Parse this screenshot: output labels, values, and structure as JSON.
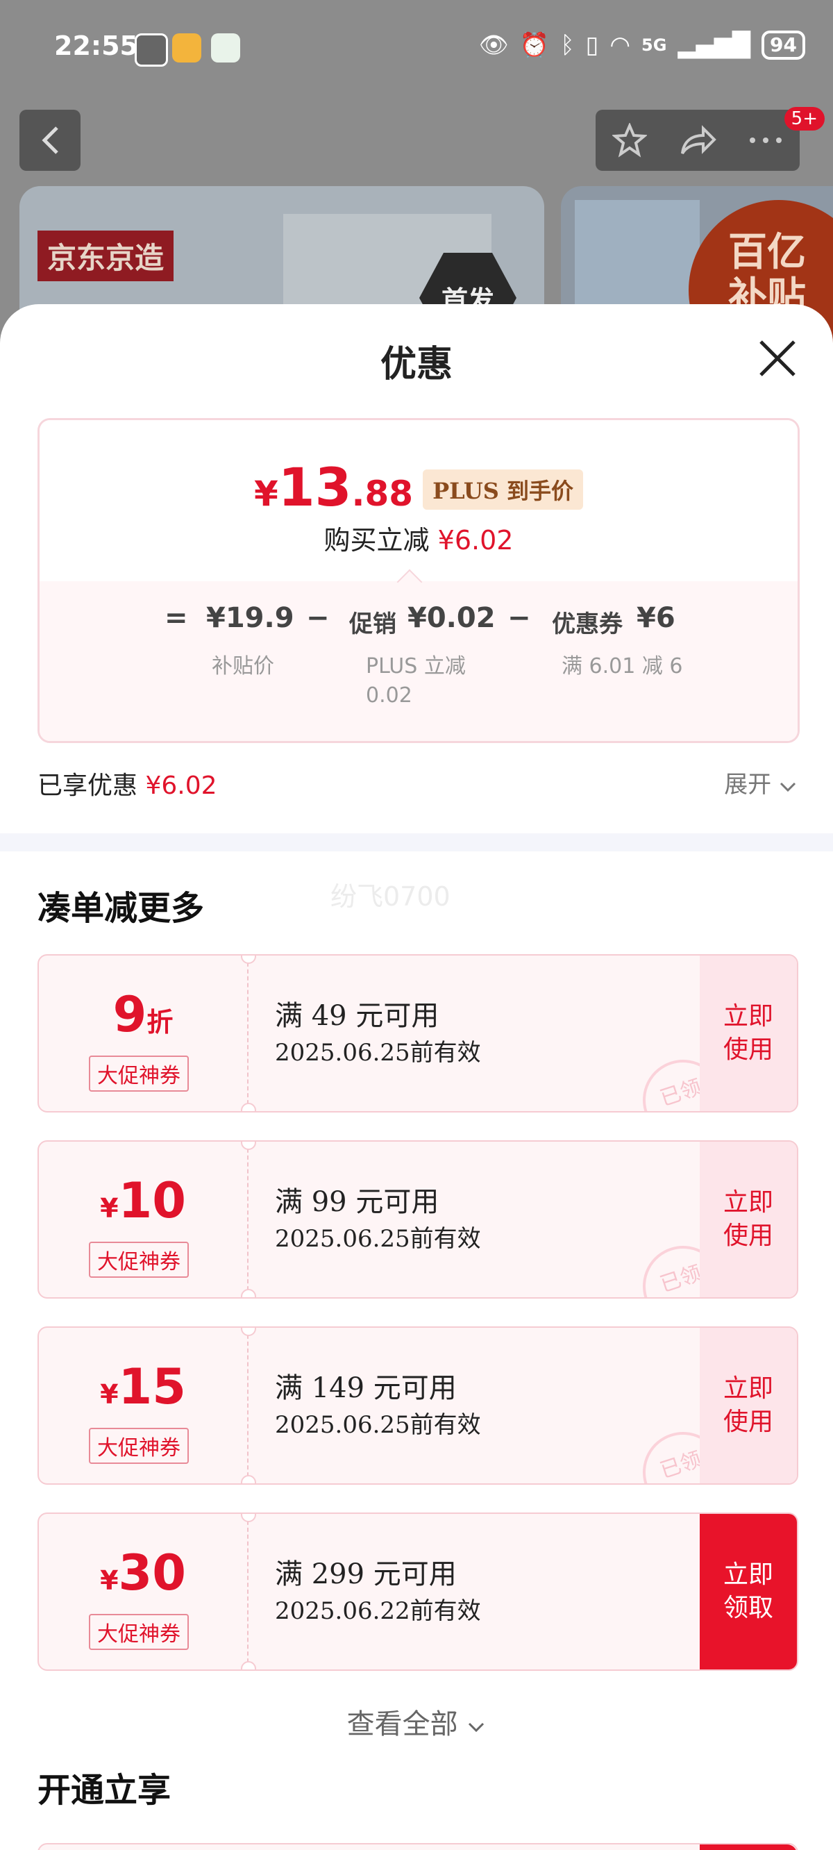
{
  "status_bar": {
    "time": "22:55",
    "network": "5G",
    "battery": "94"
  },
  "header": {
    "notification_badge": "5+"
  },
  "banners": {
    "left_tag": "京东京造",
    "left_badge": "首发",
    "right_badge": "百亿补贴"
  },
  "sheet": {
    "title": "优惠",
    "price": {
      "symbol": "¥",
      "integer": "13",
      "decimal": ".88",
      "tag": "PLUS 到手价"
    },
    "saving": {
      "label": "购买立减",
      "amount": "¥6.02"
    },
    "breakdown": {
      "equals": "=",
      "base_price": "¥19.9",
      "minus1": "−",
      "promo_label": "促销",
      "promo_amount": "¥0.02",
      "minus2": "−",
      "coupon_label": "优惠券",
      "coupon_amount": "¥6",
      "base_note": "补贴价",
      "promo_note_line1": "PLUS 立减",
      "promo_note_line2": "0.02",
      "coupon_note": "满 6.01 减 6"
    },
    "enjoyed": {
      "label": "已享优惠",
      "amount": "¥6.02"
    },
    "expand_label": "展开",
    "watermark": "纷飞0700",
    "section_more": "凑单减更多",
    "coupons": [
      {
        "value_big": "9",
        "value_small": "折",
        "prefix": "",
        "tag": "大促神券",
        "condition": "满 49 元可用",
        "validity": "2025.06.25前有效",
        "action_l1": "立即",
        "action_l2": "使用",
        "stamp": "已领"
      },
      {
        "value_big": "10",
        "value_small": "",
        "prefix": "¥",
        "tag": "大促神券",
        "condition": "满 99 元可用",
        "validity": "2025.06.25前有效",
        "action_l1": "立即",
        "action_l2": "使用",
        "stamp": "已领"
      },
      {
        "value_big": "15",
        "value_small": "",
        "prefix": "¥",
        "tag": "大促神券",
        "condition": "满 149 元可用",
        "validity": "2025.06.25前有效",
        "action_l1": "立即",
        "action_l2": "使用",
        "stamp": "已领"
      },
      {
        "value_big": "30",
        "value_small": "",
        "prefix": "¥",
        "tag": "大促神券",
        "condition": "满 299 元可用",
        "validity": "2025.06.22前有效",
        "action_l1": "立即",
        "action_l2": "领取",
        "stamp": ""
      }
    ],
    "view_all": "查看全部",
    "section_plus": "开通立享"
  },
  "colors": {
    "accent": "#e0132b",
    "tag_bg": "#fbe7d3",
    "coupon_bg": "#fef5f6"
  }
}
